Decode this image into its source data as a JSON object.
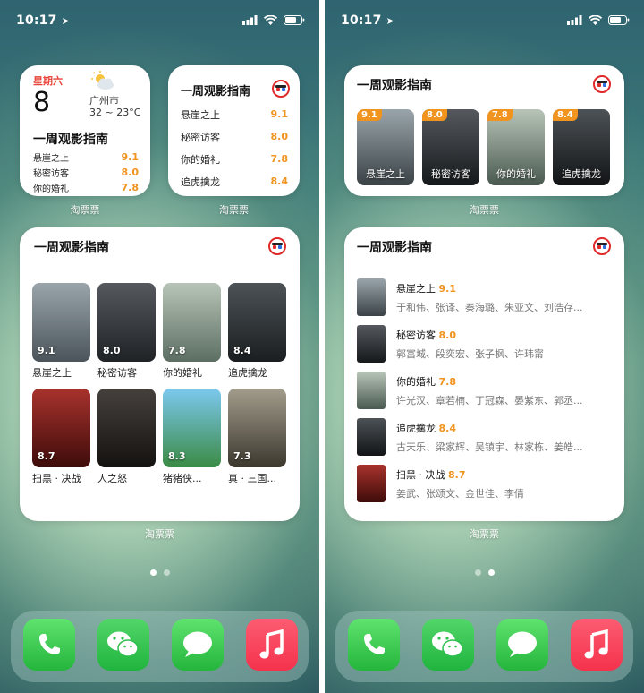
{
  "status": {
    "time": "10:17"
  },
  "calendar": {
    "weekday": "星期六",
    "day": "8",
    "city": "广州市",
    "temp": "32 ~ 23°C"
  },
  "widget_title": "一周观影指南",
  "app_label": "淘票票",
  "top_movies": [
    {
      "title": "悬崖之上",
      "score": "9.1"
    },
    {
      "title": "秘密访客",
      "score": "8.0"
    },
    {
      "title": "你的婚礼",
      "score": "7.8"
    },
    {
      "title": "追虎擒龙",
      "score": "8.4"
    }
  ],
  "grid_movies": [
    {
      "title": "悬崖之上",
      "score": "9.1",
      "color": "#6d7880"
    },
    {
      "title": "秘密访客",
      "score": "8.0",
      "color": "#3a3f44"
    },
    {
      "title": "你的婚礼",
      "score": "7.8",
      "color": "#8a9a8e"
    },
    {
      "title": "追虎擒龙",
      "score": "8.4",
      "color": "#2f3436"
    },
    {
      "title": "扫黑 · 决战",
      "score": "8.7",
      "color": "#7a1d1a"
    },
    {
      "title": "人之怒",
      "score": "",
      "color": "#2a2826"
    },
    {
      "title": "猪猪侠...",
      "score": "8.3",
      "color": "#4aa3d6"
    },
    {
      "title": "真 · 三国...",
      "score": "7.3",
      "color": "#6e6a60"
    }
  ],
  "list_movies": [
    {
      "title": "悬崖之上",
      "score": "9.1",
      "cast": "于和伟、张译、秦海璐、朱亚文、刘浩存...",
      "color": "#6d7880"
    },
    {
      "title": "秘密访客",
      "score": "8.0",
      "cast": "郭富城、段奕宏、张子枫、许玮甯",
      "color": "#3a3f44"
    },
    {
      "title": "你的婚礼",
      "score": "7.8",
      "cast": "许光汉、章若楠、丁冠森、晏紫东、郭丞...",
      "color": "#8a9a8e"
    },
    {
      "title": "追虎擒龙",
      "score": "8.4",
      "cast": "古天乐、梁家辉、吴镇宇、林家栋、姜皓...",
      "color": "#2f3436"
    },
    {
      "title": "扫黑 · 决战",
      "score": "8.7",
      "cast": "姜武、张颂文、金世佳、李倩",
      "color": "#7a1d1a"
    }
  ],
  "colors": {
    "accent": "#f0931f",
    "logo": "#e02a2a",
    "phone": "#34c759",
    "music": "#fa3d58"
  },
  "dock_icons": [
    "phone-icon",
    "wechat-icon",
    "messages-icon",
    "music-icon"
  ]
}
